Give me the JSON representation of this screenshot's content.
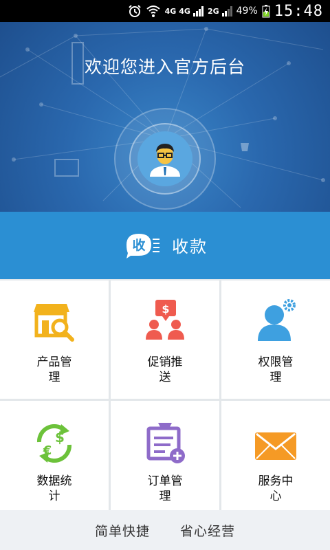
{
  "status_bar": {
    "network_1": "4G",
    "network_2": "4G",
    "network_3": "2G",
    "battery": "49%",
    "time": "15:48"
  },
  "hero": {
    "title": "欢迎您进入官方后台"
  },
  "payment": {
    "icon_text": "收",
    "label": "收款"
  },
  "grid": {
    "items": [
      {
        "name": "product",
        "line1": "产品管",
        "line2": "理",
        "icon": "store-search-icon",
        "color": "#f2b21c"
      },
      {
        "name": "promo",
        "line1": "促销推",
        "line2": "送",
        "icon": "promotion-icon",
        "color": "#ef5b4f"
      },
      {
        "name": "permission",
        "line1": "权限管",
        "line2": "理",
        "icon": "user-gear-icon",
        "color": "#3ea0e0"
      },
      {
        "name": "stats",
        "line1": "数据统",
        "line2": "计",
        "icon": "currency-exchange-icon",
        "color": "#6cc23a"
      },
      {
        "name": "orders",
        "line1": "订单管",
        "line2": "理",
        "icon": "order-add-icon",
        "color": "#8e6bc9"
      },
      {
        "name": "service",
        "line1": "服务中",
        "line2": "心",
        "icon": "mail-icon",
        "color": "#f59a25"
      }
    ]
  },
  "footer": {
    "left": "简单快捷",
    "right": "省心经营"
  },
  "colors": {
    "hero_blue": "#2a68ae",
    "bar_blue": "#2b8fd3"
  }
}
